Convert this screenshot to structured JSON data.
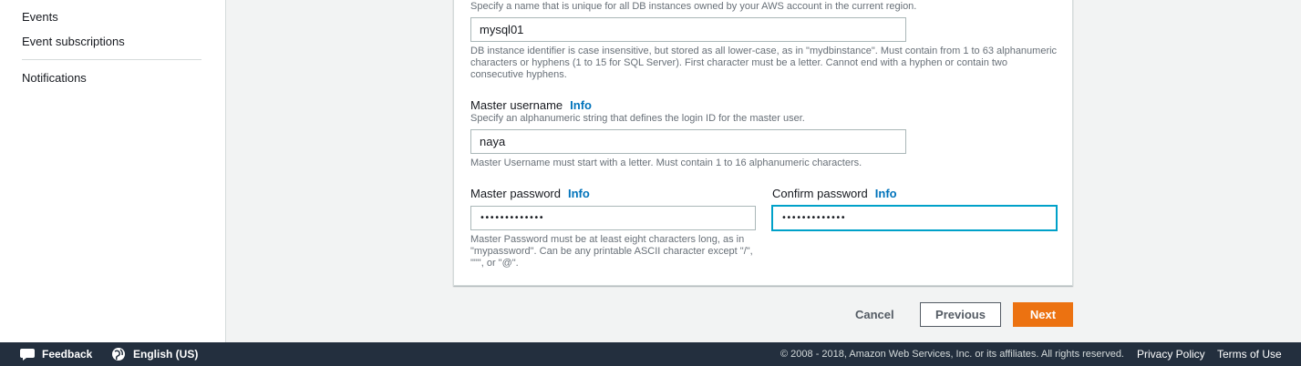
{
  "sidebar": {
    "items": [
      {
        "label": "Events"
      },
      {
        "label": "Event subscriptions"
      },
      {
        "label": "Notifications"
      }
    ]
  },
  "form": {
    "db_identifier": {
      "description": "Specify a name that is unique for all DB instances owned by your AWS account in the current region.",
      "value": "mysql01",
      "constraint": "DB instance identifier is case insensitive, but stored as all lower-case, as in \"mydbinstance\". Must contain from 1 to 63 alphanumeric characters or hyphens (1 to 15 for SQL Server). First character must be a letter. Cannot end with a hyphen or contain two consecutive hyphens."
    },
    "master_username": {
      "label": "Master username",
      "info": "Info",
      "description": "Specify an alphanumeric string that defines the login ID for the master user.",
      "value": "naya",
      "constraint": "Master Username must start with a letter. Must contain 1 to 16 alphanumeric characters."
    },
    "master_password": {
      "label": "Master password",
      "info": "Info",
      "value": "•••••••••••••",
      "constraint": "Master Password must be at least eight characters long, as in \"mypassword\". Can be any printable ASCII character except \"/\", \"\"\", or \"@\"."
    },
    "confirm_password": {
      "label": "Confirm password",
      "info": "Info",
      "value": "•••••••••••••"
    }
  },
  "actions": {
    "cancel": "Cancel",
    "previous": "Previous",
    "next": "Next"
  },
  "footer": {
    "feedback": "Feedback",
    "language": "English (US)",
    "copyright": "© 2008 - 2018, Amazon Web Services, Inc. or its affiliates. All rights reserved.",
    "privacy": "Privacy Policy",
    "terms": "Terms of Use"
  }
}
